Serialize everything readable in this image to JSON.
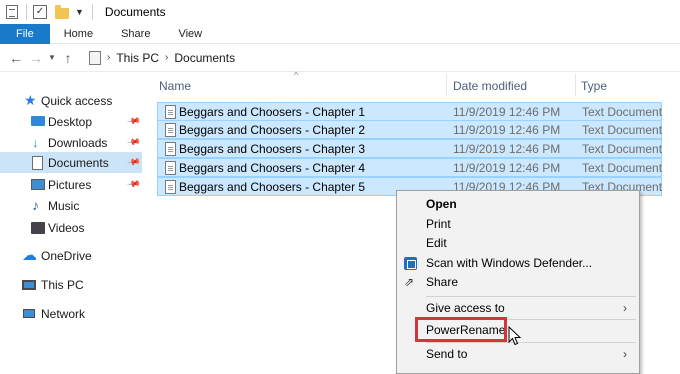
{
  "window": {
    "title": "Documents"
  },
  "quick_access": {
    "icons": [
      "properties-icon",
      "checkmark-icon",
      "new-folder-icon",
      "customize-dropdown-icon"
    ]
  },
  "ribbon": {
    "tabs": [
      "File",
      "Home",
      "Share",
      "View"
    ]
  },
  "address": {
    "crumbs": [
      "This PC",
      "Documents"
    ]
  },
  "sidebar": {
    "items": [
      {
        "label": "Quick access",
        "icon": "star-icon"
      },
      {
        "label": "Desktop",
        "icon": "desktop-icon",
        "pinned": true
      },
      {
        "label": "Downloads",
        "icon": "downloads-icon",
        "pinned": true
      },
      {
        "label": "Documents",
        "icon": "documents-icon",
        "pinned": true,
        "selected": true
      },
      {
        "label": "Pictures",
        "icon": "pictures-icon",
        "pinned": true
      },
      {
        "label": "Music",
        "icon": "music-icon"
      },
      {
        "label": "Videos",
        "icon": "videos-icon"
      },
      {
        "label": "OneDrive",
        "icon": "cloud-icon"
      },
      {
        "label": "This PC",
        "icon": "computer-icon"
      },
      {
        "label": "Network",
        "icon": "network-icon"
      }
    ]
  },
  "columns": {
    "name": "Name",
    "date": "Date modified",
    "type": "Type"
  },
  "files": [
    {
      "name": "Beggars and Choosers - Chapter 1",
      "date": "11/9/2019 12:46 PM",
      "type": "Text Document"
    },
    {
      "name": "Beggars and Choosers - Chapter 2",
      "date": "11/9/2019 12:46 PM",
      "type": "Text Document"
    },
    {
      "name": "Beggars and Choosers - Chapter 3",
      "date": "11/9/2019 12:46 PM",
      "type": "Text Document"
    },
    {
      "name": "Beggars and Choosers - Chapter 4",
      "date": "11/9/2019 12:46 PM",
      "type": "Text Document"
    },
    {
      "name": "Beggars and Choosers - Chapter 5",
      "date": "11/9/2019 12:46 PM",
      "type": "Text Document"
    }
  ],
  "context_menu": {
    "items": [
      {
        "label": "Open",
        "bold": true
      },
      {
        "label": "Print"
      },
      {
        "label": "Edit"
      },
      {
        "label": "Scan with Windows Defender...",
        "icon": "defender-icon"
      },
      {
        "label": "Share",
        "icon": "share-icon"
      },
      {
        "label": "Give access to",
        "submenu": true
      },
      {
        "label": "PowerRename",
        "highlighted": true
      },
      {
        "label": "Send to",
        "submenu": true
      }
    ]
  },
  "colors": {
    "accent": "#1979ca",
    "selection": "#cce8ff",
    "highlight_box": "#d3353b"
  }
}
